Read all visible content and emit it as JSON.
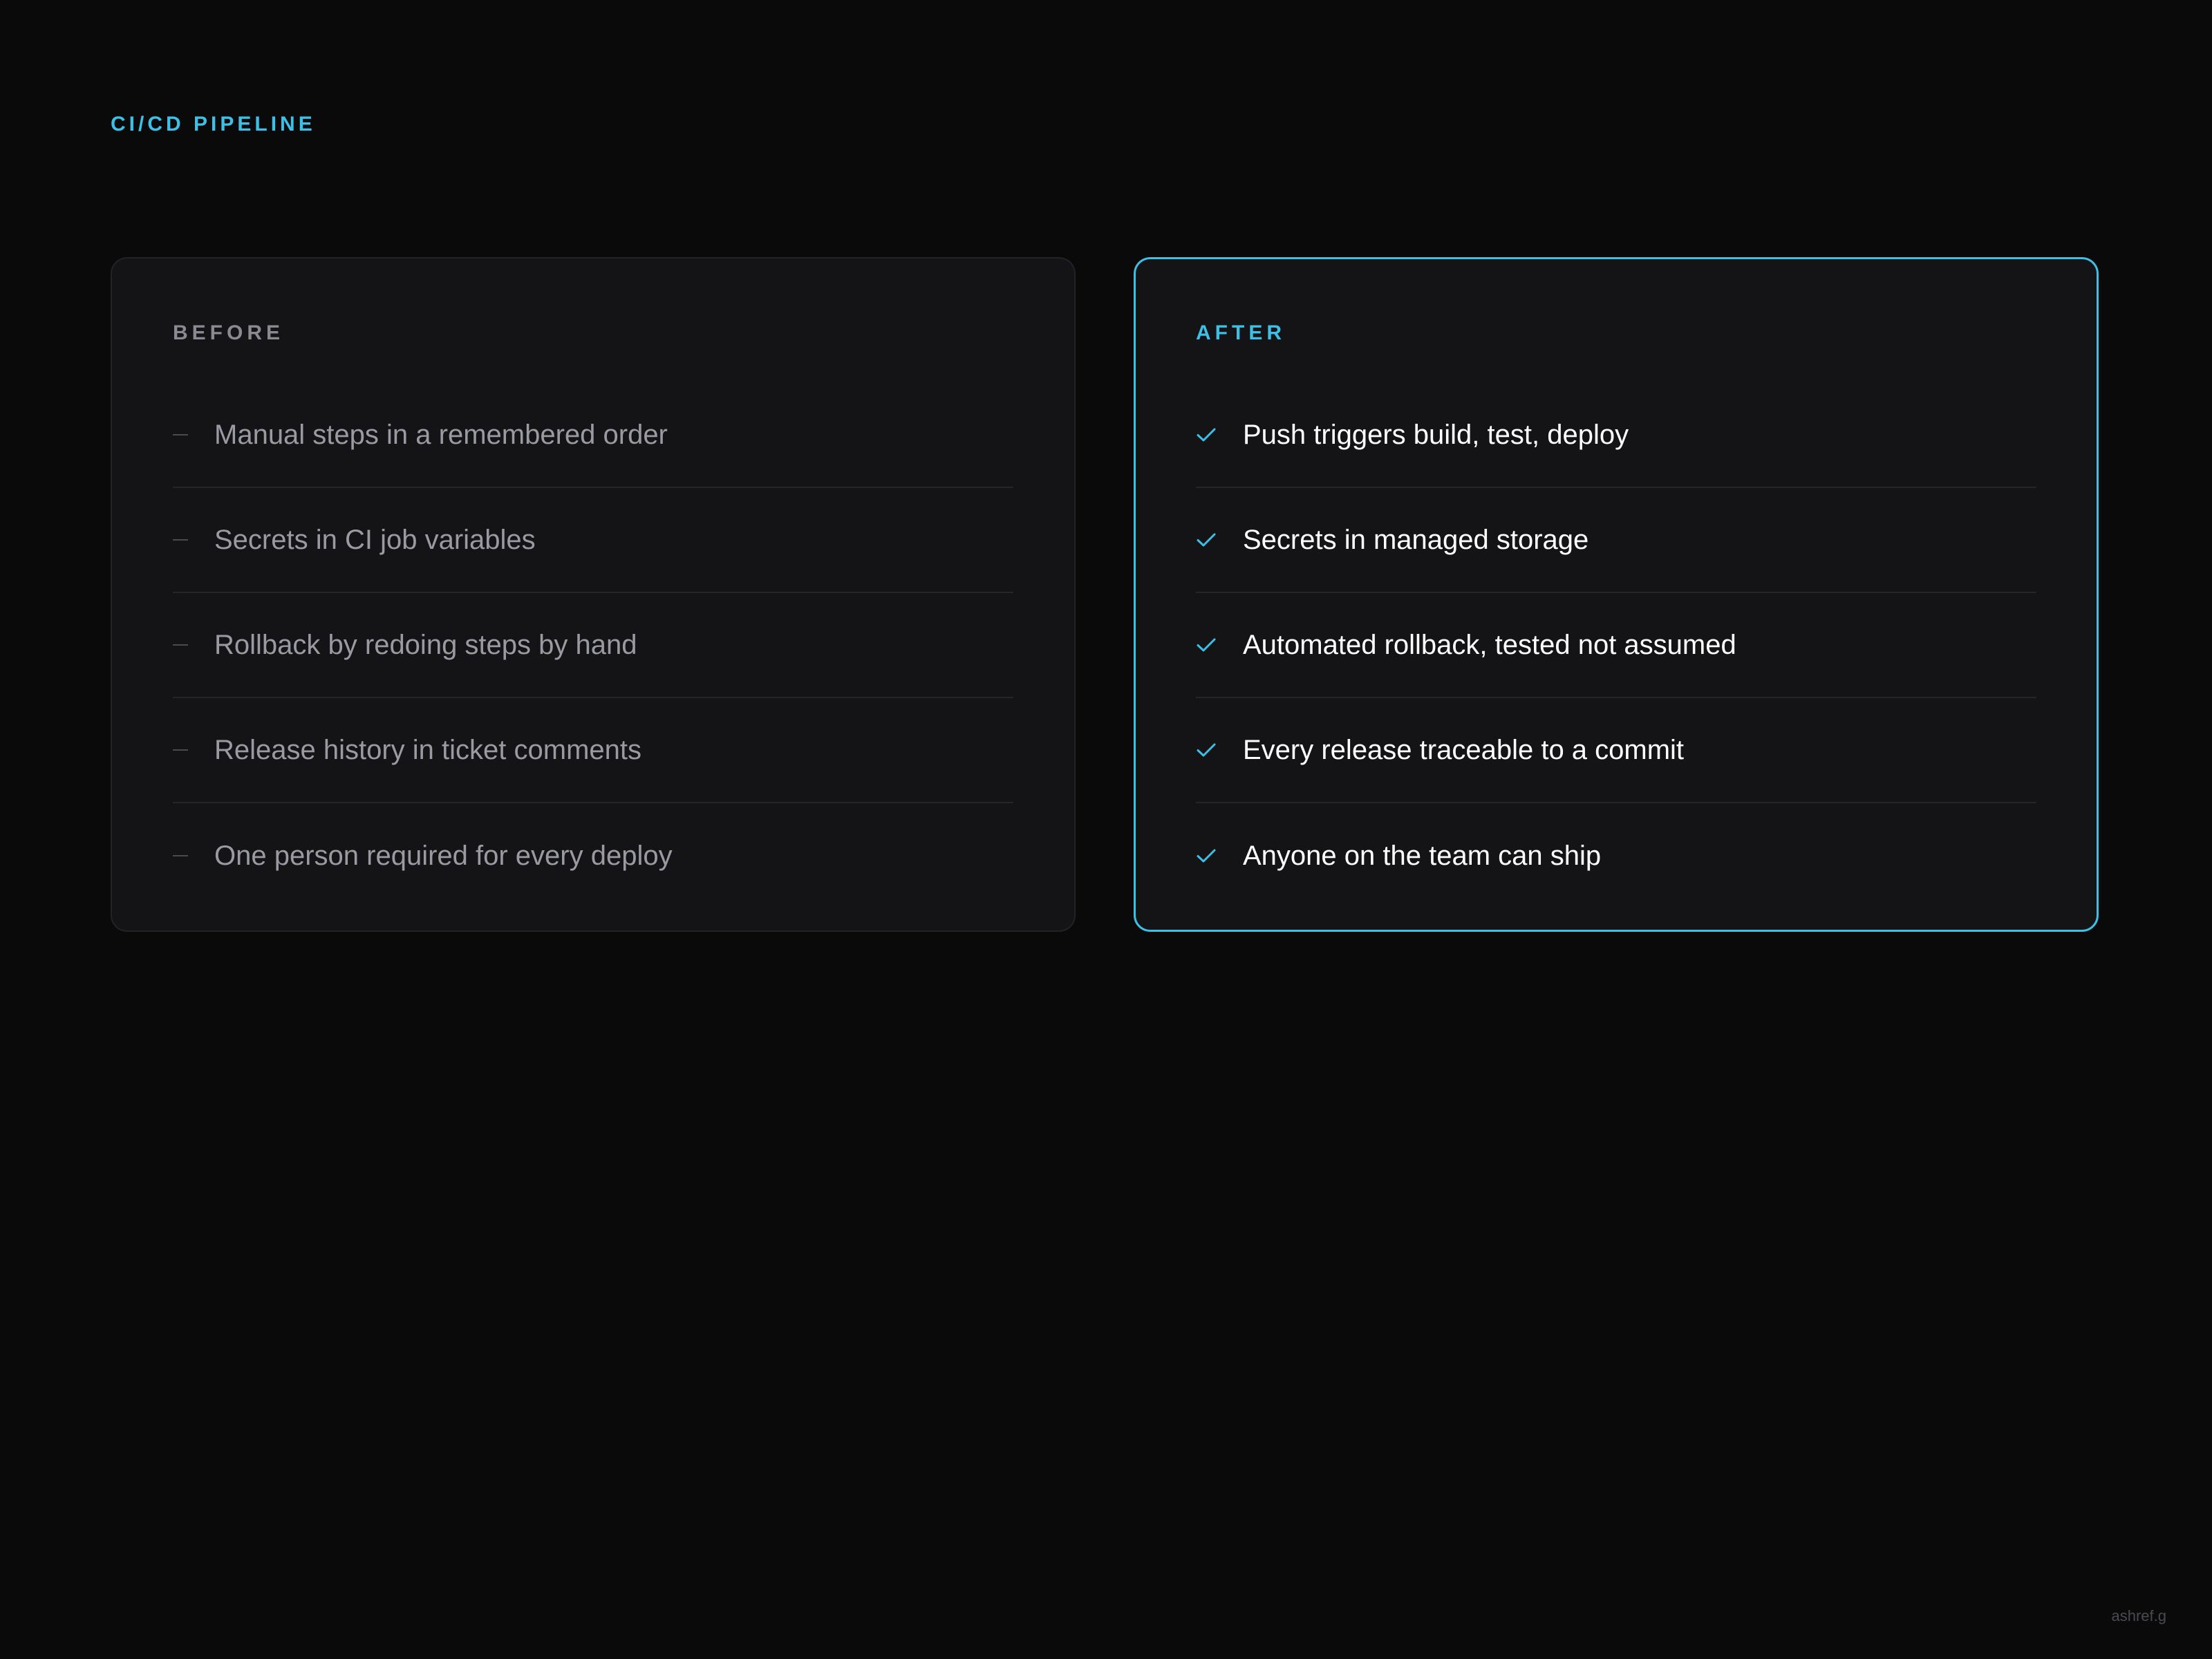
{
  "eyebrow": "CI/CD PIPELINE",
  "before": {
    "heading": "BEFORE",
    "marker_icon": "dash-icon",
    "items": [
      "Manual steps in a remembered order",
      "Secrets in CI job variables",
      "Rollback by redoing steps by hand",
      "Release history in ticket comments",
      "One person required for every deploy"
    ]
  },
  "after": {
    "heading": "AFTER",
    "marker_icon": "check-icon",
    "items": [
      "Push triggers build, test, deploy",
      "Secrets in managed storage",
      "Automated rollback, tested not assumed",
      "Every release traceable to a commit",
      "Anyone on the team can ship"
    ]
  },
  "signature": "ashref.g",
  "colors": {
    "background": "#0a0a0b",
    "card": "#141417",
    "accent": "#3ec0e6",
    "muted_text": "#9a9aa2",
    "divider": "#242429"
  }
}
